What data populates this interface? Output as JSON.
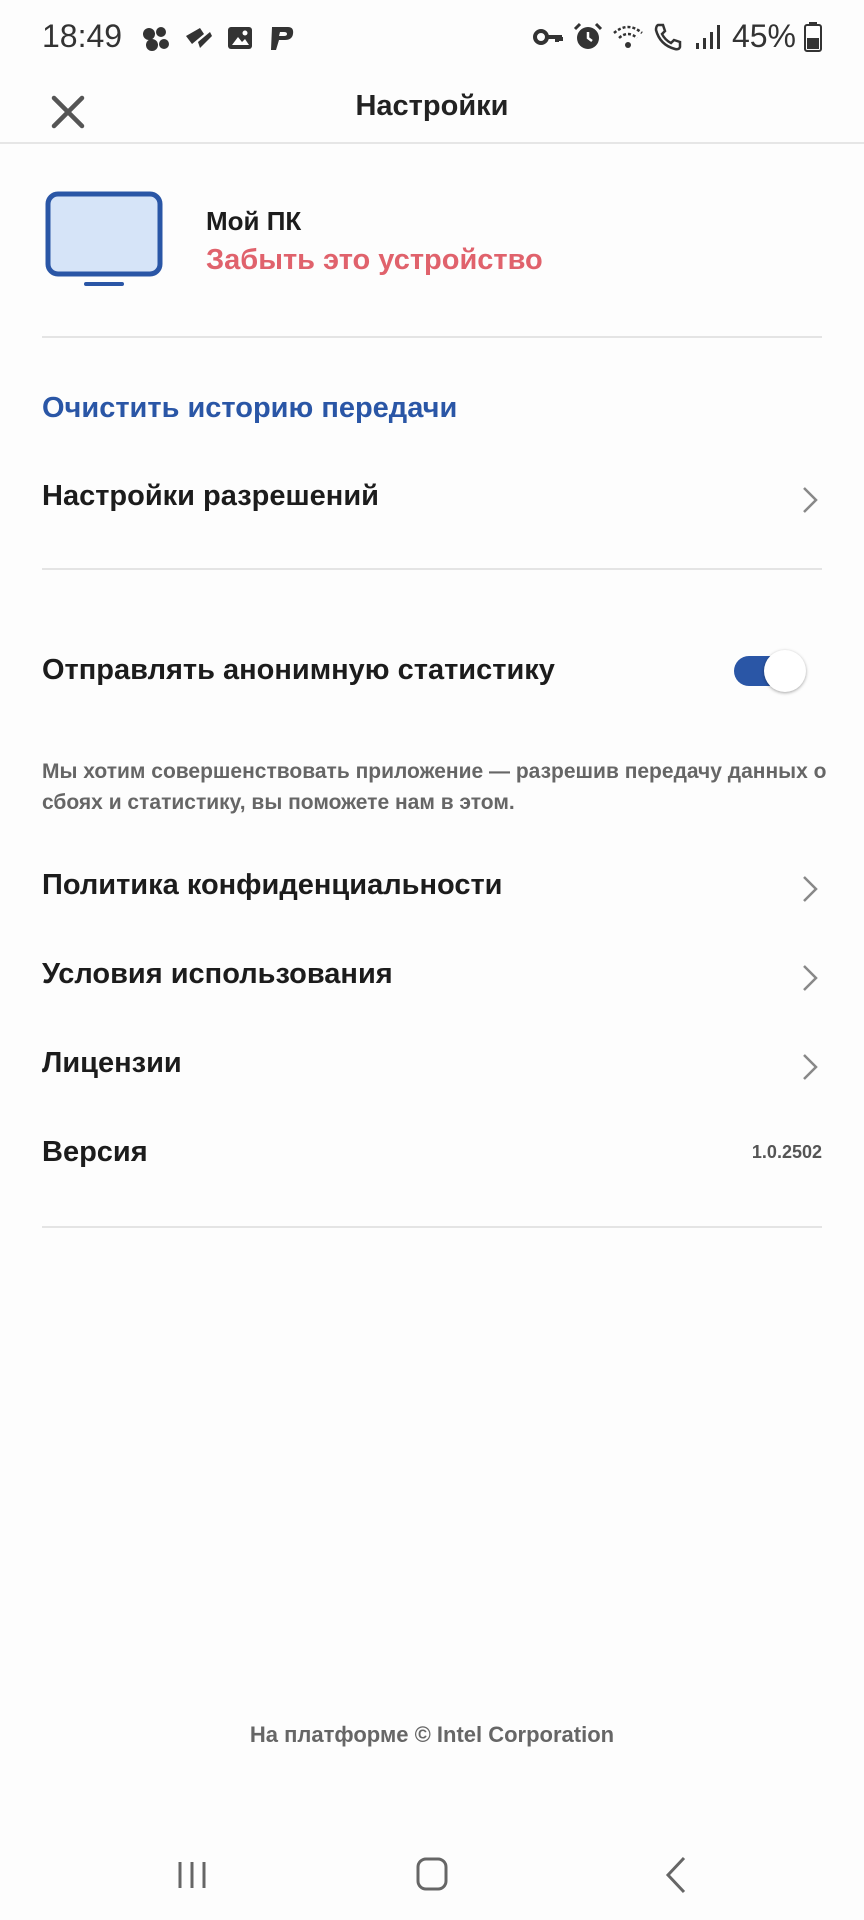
{
  "status_bar": {
    "time": "18:49",
    "battery": "45%",
    "left_icons": [
      "multi-dot-icon",
      "tilted-app-icon",
      "image-icon",
      "p-app-icon"
    ],
    "right_icons": [
      "key-icon",
      "alarm-icon",
      "wifi-icon",
      "call-icon",
      "signal-icon",
      "battery-icon"
    ]
  },
  "header": {
    "title": "Настройки",
    "close_icon": "close-icon"
  },
  "device": {
    "name": "Мой ПК",
    "forget_label": "Забыть это устройство",
    "icon": "monitor-icon"
  },
  "actions": {
    "clear_history": "Очистить историю передачи",
    "permissions": "Настройки разрешений"
  },
  "stats": {
    "label": "Отправлять анонимную статистику",
    "enabled": true,
    "description": "Мы хотим совершенствовать приложение — разрешив передачу данных о сбоях и статистику, вы поможете нам в этом."
  },
  "links": {
    "privacy": "Политика конфиденциальности",
    "terms": "Условия использования",
    "licenses": "Лицензии"
  },
  "version": {
    "label": "Версия",
    "value": "1.0.2502"
  },
  "footer": {
    "text": "На платформе © Intel Corporation"
  },
  "colors": {
    "accent": "#2a56a6",
    "danger": "#e0626c"
  }
}
